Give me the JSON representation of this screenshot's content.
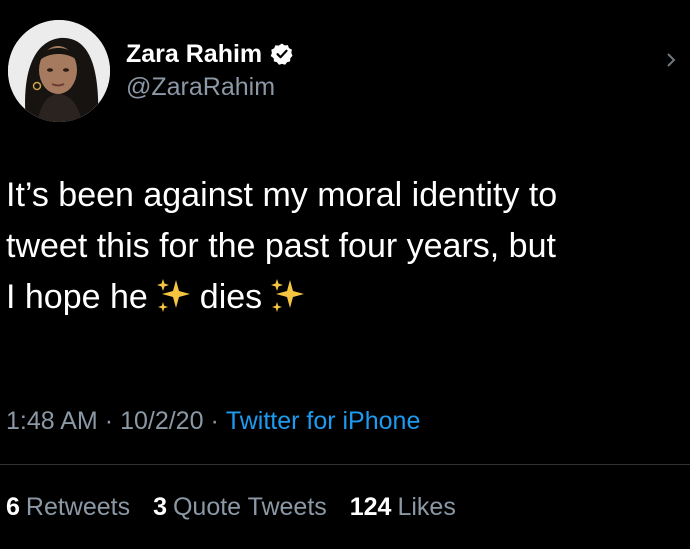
{
  "tweet": {
    "author": {
      "display_name": "Zara Rahim",
      "handle": "@ZaraRahim",
      "verified": true,
      "avatar_icon": "profile-photo"
    },
    "text_lines": [
      "It’s been against my moral identity to",
      "tweet this for the past four years, but"
    ],
    "text_last_line": {
      "part1": "I hope he",
      "part2": "dies"
    },
    "emoji_icon": "sparkles-icon",
    "meta": {
      "time": "1:48 AM",
      "separator": "·",
      "date": "10/2/20",
      "source": "Twitter for iPhone"
    },
    "stats": {
      "retweets_count": "6",
      "retweets_label": "Retweets",
      "quotes_count": "3",
      "quotes_label": "Quote Tweets",
      "likes_count": "124",
      "likes_label": "Likes"
    }
  },
  "colors": {
    "background": "#000000",
    "text": "#ffffff",
    "secondary_text": "#8b98a5",
    "link": "#1d9bf0",
    "divider": "#2f3336",
    "sparkle": "#f5c542"
  }
}
